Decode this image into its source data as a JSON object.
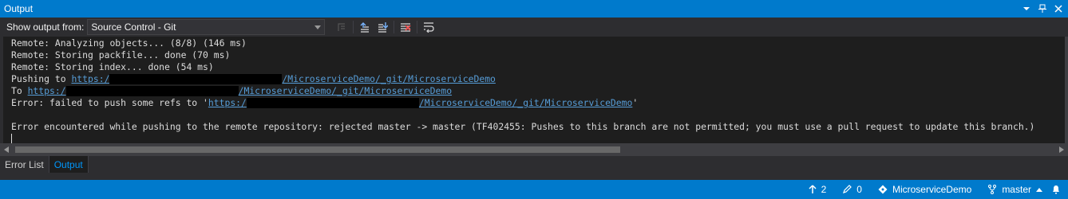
{
  "window": {
    "title": "Output"
  },
  "toolbar": {
    "show_output_label": "Show output from:",
    "source_selected": "Source Control - Git"
  },
  "output": {
    "lines": {
      "l1": "Remote: Analyzing objects... (8/8) (146 ms)",
      "l2": "Remote: Storing packfile... done (70 ms)",
      "l3": "Remote: Storing index... done (54 ms)",
      "l4_prefix": "Pushing to ",
      "l4_scheme": "https:/",
      "l4_path": "/MicroserviceDemo/_git/MicroserviceDemo",
      "l5_prefix": "To ",
      "l5_scheme": "https:/",
      "l5_path": "/MicroserviceDemo/_git/MicroserviceDemo",
      "l6_prefix": "Error: failed to push some refs to '",
      "l6_scheme": "https:/",
      "l6_path": "/MicroserviceDemo/_git/MicroserviceDemo",
      "l6_suffix": "'",
      "l8": "Error encountered while pushing to the remote repository: rejected master -> master (TF402455: Pushes to this branch are not permitted; you must use a pull request to update this branch.)"
    }
  },
  "tabs": {
    "error_list": "Error List",
    "output": "Output"
  },
  "statusbar": {
    "commits_up": "2",
    "pending_changes": "0",
    "repository": "MicroserviceDemo",
    "branch": "master"
  },
  "colors": {
    "accent": "#007acc",
    "output_bg": "#1e1e1e",
    "link": "#569cd6",
    "active_tab": "#0097fb"
  }
}
